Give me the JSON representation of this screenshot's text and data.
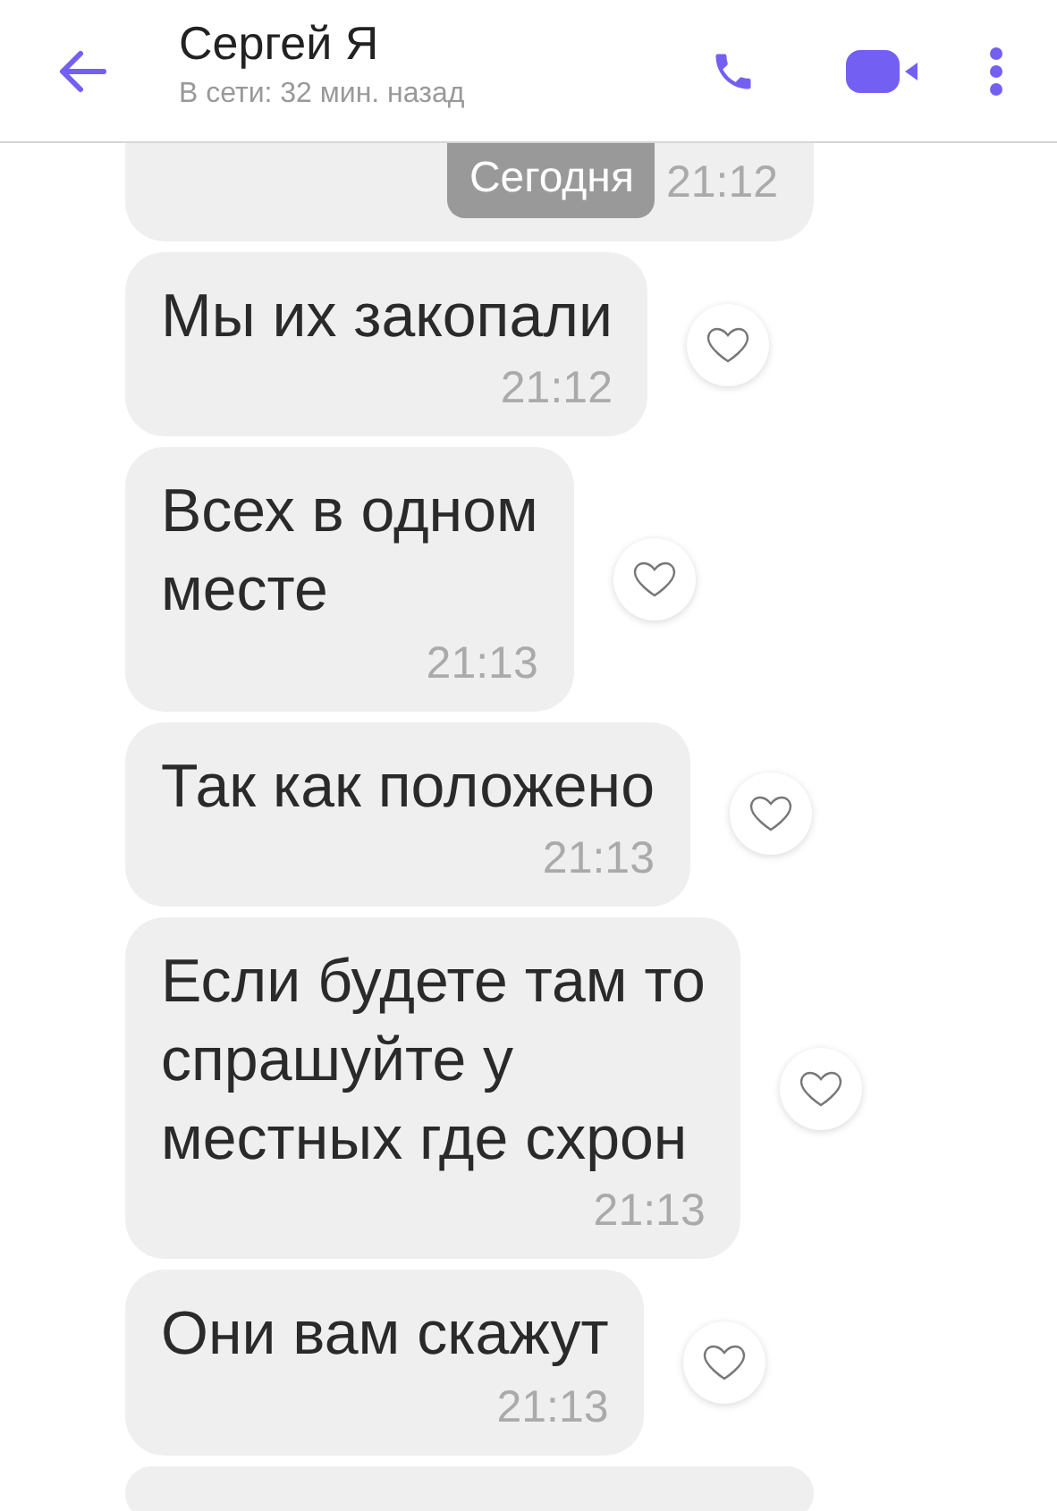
{
  "header": {
    "title": "Сергей Я",
    "status": "В сети: 32 мин. назад"
  },
  "date_pill": "Сегодня",
  "top_time": "21:12",
  "messages": [
    {
      "text": "Мы их закопали",
      "time": "21:12",
      "liked": false
    },
    {
      "text": "Всех в одном\nместе",
      "time": "21:13",
      "liked": false
    },
    {
      "text": "Так как положено",
      "time": "21:13",
      "liked": false
    },
    {
      "text": "Если будете там то\nспрашуйте у\nместных где схрон",
      "time": "21:13",
      "liked": false
    },
    {
      "text": "Они вам скажут",
      "time": "21:13",
      "liked": false
    }
  ]
}
